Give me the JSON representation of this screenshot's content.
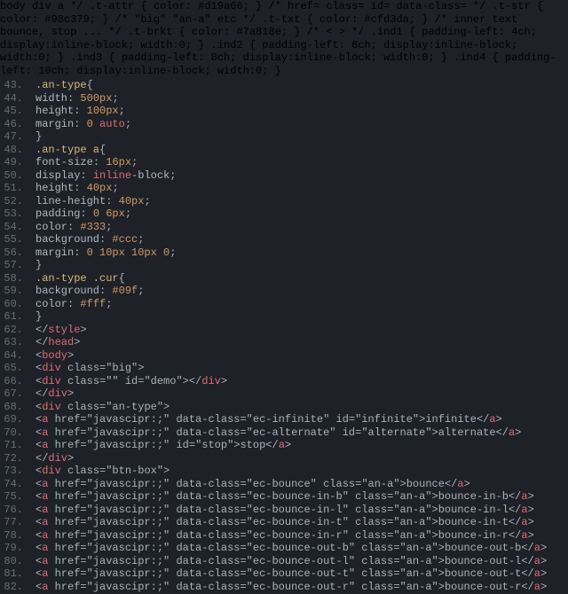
{
  "startLine": 43,
  "endLine": 82,
  "css": {
    "anType": {
      "selector": ".an-type",
      "rules": [
        {
          "prop": "width",
          "val_num": "500px"
        },
        {
          "prop": "height",
          "val_num": "100px"
        },
        {
          "prop": "margin",
          "val": "0 auto"
        }
      ]
    },
    "anTypeA": {
      "selector": ".an-type a",
      "rules": [
        {
          "prop": "font-size",
          "val_num": "16px"
        },
        {
          "prop": "display",
          "val": "inline-block"
        },
        {
          "prop": "height",
          "val_num": "40px"
        },
        {
          "prop": "line-height",
          "val_num": "40px"
        },
        {
          "prop": "padding",
          "val": "0 6px"
        },
        {
          "prop": "color",
          "val_num": "#333"
        },
        {
          "prop": "background",
          "val_num": "#ccc"
        },
        {
          "prop": "margin",
          "val": "0 10px 10px 0"
        }
      ]
    },
    "anTypeCur": {
      "selector": ".an-type .cur",
      "rules": [
        {
          "prop": "background",
          "val_num": "#09f"
        },
        {
          "prop": "color",
          "val_num": "#fff"
        }
      ]
    }
  },
  "closeStyle": "style",
  "closeHead": "head",
  "body": "body",
  "divBig": {
    "tag": "div",
    "cls": "big"
  },
  "divDemo": {
    "tag": "div",
    "cls": "",
    "id": "demo"
  },
  "closeDiv": "div",
  "divAnType": {
    "tag": "div",
    "cls": "an-type"
  },
  "aInfinite": {
    "href": "javascipr:;",
    "dc": "ec-infinite",
    "id": "infinite",
    "txt": "infinite"
  },
  "aAlternate": {
    "href": "javascipr:;",
    "dc": "ec-alternate",
    "id": "alternate",
    "txt": "alternate"
  },
  "aStop": {
    "href": "javascipr:;",
    "id": "stop",
    "txt": "stop"
  },
  "divBtnBox": {
    "tag": "div",
    "cls": "btn-box"
  },
  "btn": [
    {
      "href": "javascipr:;",
      "dc": "ec-bounce",
      "cls": "an-a",
      "txt": "bounce"
    },
    {
      "href": "javascipr:;",
      "dc": "ec-bounce-in-b",
      "cls": "an-a",
      "txt": "bounce-in-b"
    },
    {
      "href": "javascipr:;",
      "dc": "ec-bounce-in-l",
      "cls": "an-a",
      "txt": "bounce-in-l"
    },
    {
      "href": "javascipr:;",
      "dc": "ec-bounce-in-t",
      "cls": "an-a",
      "txt": "bounce-in-t"
    },
    {
      "href": "javascipr:;",
      "dc": "ec-bounce-in-r",
      "cls": "an-a",
      "txt": "bounce-in-r"
    },
    {
      "href": "javascipr:;",
      "dc": "ec-bounce-out-b",
      "cls": "an-a",
      "txt": "bounce-out-b"
    },
    {
      "href": "javascipr:;",
      "dc": "ec-bounce-out-l",
      "cls": "an-a",
      "txt": "bounce-out-l"
    },
    {
      "href": "javascipr:;",
      "dc": "ec-bounce-out-t",
      "cls": "an-a",
      "txt": "bounce-out-t"
    },
    {
      "href": "javascipr:;",
      "dc": "ec-bounce-out-r",
      "cls": "an-a",
      "txt": "bounce-out-r"
    }
  ]
}
